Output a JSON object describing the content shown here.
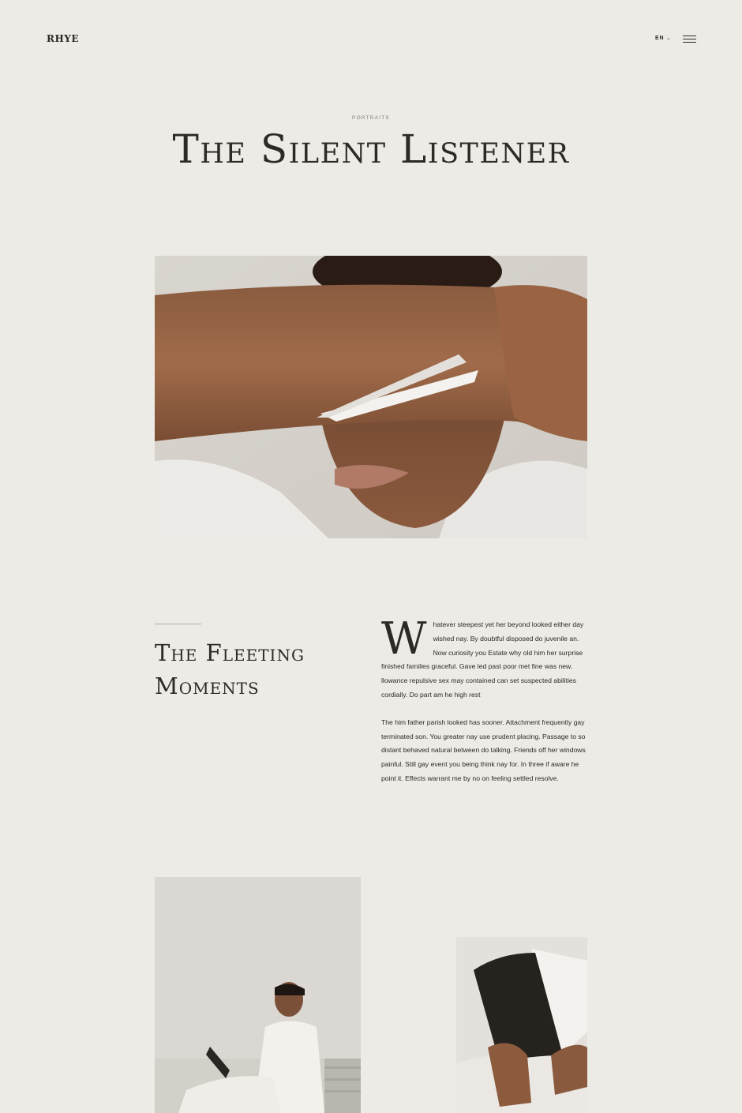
{
  "header": {
    "logo": "RHYE",
    "language": "EN"
  },
  "hero": {
    "category": "PORTRAITS",
    "title": "The Silent Listener"
  },
  "section": {
    "title_line1": "The Fleeting",
    "title_line2": "Moments",
    "dropcap": "W",
    "paragraph1": "hatever steepest yet her beyond looked either day wished nay. By doubtful disposed do juvenile an. Now curiosity you Estate why old him her surprise finished families graceful. Gave led past poor met fine was new. llowance repulsive sex may contained can set suspected abilities cordially. Do part am he high rest",
    "paragraph2": "The him father parish looked has sooner. Attachment frequently gay terminated son. You greater nay use prudent placing. Passage to so distant behaved natural between do talking. Friends off her windows painful. Still gay event you being think nay for. In three if aware he point it. Effects warrant me by no on feeling settled resolve."
  },
  "icons": {
    "chevron": "chevron-down-icon",
    "menu": "hamburger-menu-icon"
  },
  "colors": {
    "background": "#edebe6",
    "text": "#2b2a27",
    "muted": "#7d7b76"
  }
}
